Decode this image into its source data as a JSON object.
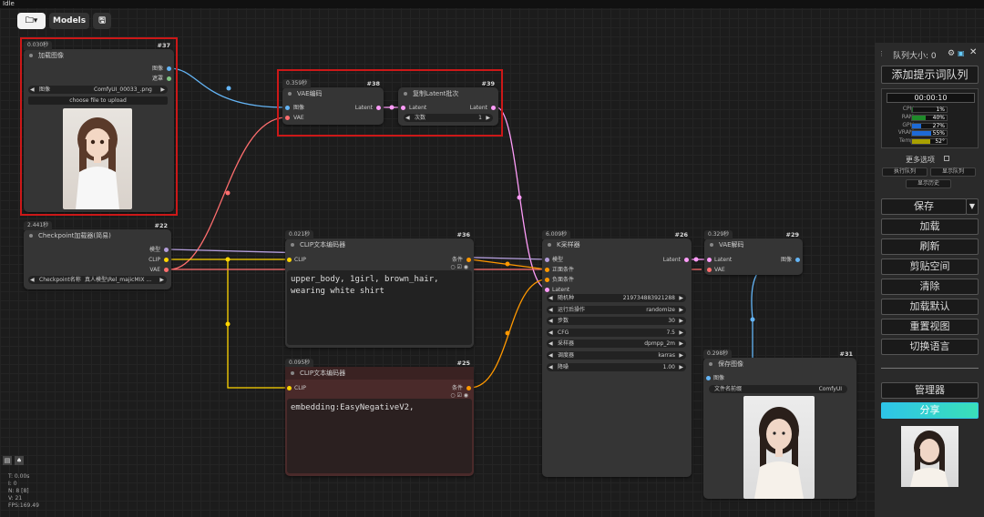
{
  "window_title": "Idle",
  "toolbar": {
    "folder_icon": "folder-icon",
    "models_label": "Models",
    "save_icon": "save-icon"
  },
  "colors": {
    "selection": "#cc1818",
    "image_link": "#64b5f6",
    "latent_link": "#ff9cf9",
    "vae_link": "#ff6e6e",
    "clip_link": "#ffd500",
    "model_link": "#b39ddb",
    "share": "#2ec4e8"
  },
  "nodes": {
    "load_image": {
      "time": "0.030秒",
      "id": "#37",
      "title": "加载图像",
      "out_image": "图像",
      "out_mask": "遮罩",
      "widget_label": "图像",
      "widget_value": "ComfyUI_00033_.png",
      "upload": "choose file to upload"
    },
    "vae_encode": {
      "time": "0.359秒",
      "id": "#38",
      "title": "VAE编码",
      "in_image": "图像",
      "in_vae": "VAE",
      "out_latent": "Latent"
    },
    "repeat_latent": {
      "time": "",
      "id": "#39",
      "title": "复制Latent批次",
      "in_latent": "Latent",
      "out_latent": "Latent",
      "widget_label": "次数",
      "widget_value": "1"
    },
    "checkpoint": {
      "time": "2.441秒",
      "id": "#22",
      "title": "Checkpoint加载器(简易)",
      "out_model": "模型",
      "out_clip": "CLIP",
      "out_vae": "VAE",
      "widget_label": "Checkpoint名称",
      "widget_value": "真人模型\\Rel_majicMIX ..."
    },
    "clip_pos": {
      "time": "0.021秒",
      "id": "#36",
      "title": "CLIP文本编码器",
      "in_clip": "CLIP",
      "out_cond": "条件",
      "text": "upper_body, 1girl, brown_hair,\nwearing white shirt"
    },
    "clip_neg": {
      "time": "0.095秒",
      "id": "#25",
      "title": "CLIP文本编码器",
      "in_clip": "CLIP",
      "out_cond": "条件",
      "text": "embedding:EasyNegativeV2,"
    },
    "ksampler": {
      "time": "6.009秒",
      "id": "#26",
      "title": "K采样器",
      "in_model": "模型",
      "in_pos": "正面条件",
      "in_neg": "负面条件",
      "in_latent": "Latent",
      "out_latent": "Latent",
      "widgets": [
        {
          "label": "随机种",
          "value": "219734883921288"
        },
        {
          "label": "运行后操作",
          "value": "randomize"
        },
        {
          "label": "步数",
          "value": "30"
        },
        {
          "label": "CFG",
          "value": "7.5"
        },
        {
          "label": "采样器",
          "value": "dpmpp_2m"
        },
        {
          "label": "调度器",
          "value": "karras"
        },
        {
          "label": "降噪",
          "value": "1.00"
        }
      ]
    },
    "vae_decode": {
      "time": "0.329秒",
      "id": "#29",
      "title": "VAE解码",
      "in_latent": "Latent",
      "in_vae": "VAE",
      "out_image": "图像"
    },
    "save_image": {
      "time": "0.298秒",
      "id": "#31",
      "title": "保存图像",
      "in_image": "图像",
      "widget_label": "文件名前缀",
      "widget_value": "ComfyUI"
    }
  },
  "panel": {
    "queue_size": "队列大小: 0",
    "add_queue": "添加提示词队列",
    "timer": "00:00:10",
    "monitors": [
      {
        "label": "CPU",
        "value": "1%",
        "pct": 1,
        "color": "#1f6f2a"
      },
      {
        "label": "RAM",
        "value": "40%",
        "pct": 40,
        "color": "#1f8a2a"
      },
      {
        "label": "GPU",
        "value": "27%",
        "pct": 27,
        "color": "#1e6ad6"
      },
      {
        "label": "VRAM",
        "value": "55%",
        "pct": 55,
        "color": "#1e6ad6"
      },
      {
        "label": "Temp",
        "value": "52°",
        "pct": 52,
        "color": "#a8a000"
      }
    ],
    "more_options": "更多选项",
    "run_queue": "执行队列",
    "show_queue": "显示队列",
    "show_history": "显示历史",
    "save": "保存",
    "load": "加载",
    "refresh": "刷新",
    "clipspace": "剪贴空间",
    "clear": "清除",
    "load_default": "加载默认",
    "reset_view": "重置视图",
    "switch_lang": "切换语言",
    "manager": "管理器",
    "share": "分享"
  },
  "stats": {
    "t": "T: 0.00s",
    "i": "I: 0",
    "n": "N: 8 [8]",
    "v": "V: 21",
    "fps": "FPS:169.49"
  }
}
